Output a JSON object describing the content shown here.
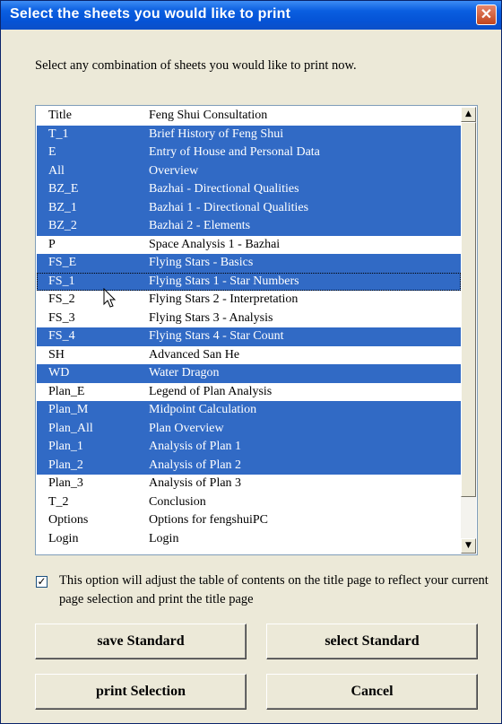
{
  "window": {
    "title": "Select the sheets you would like to print",
    "close": "✕"
  },
  "instruction": "Select any combination of sheets you would like to print now.",
  "sheets": [
    {
      "code": "Title",
      "name": "Feng Shui Consultation",
      "selected": false
    },
    {
      "code": "T_1",
      "name": "Brief History of  Feng Shui",
      "selected": true
    },
    {
      "code": "E",
      "name": "Entry of House and Personal Data",
      "selected": true
    },
    {
      "code": "All",
      "name": "Overview",
      "selected": true
    },
    {
      "code": "BZ_E",
      "name": "Bazhai - Directional Qualities",
      "selected": true
    },
    {
      "code": "BZ_1",
      "name": "Bazhai 1 - Directional Qualities",
      "selected": true
    },
    {
      "code": "BZ_2",
      "name": "Bazhai 2 - Elements",
      "selected": true
    },
    {
      "code": "P",
      "name": "Space Analysis 1 - Bazhai",
      "selected": false
    },
    {
      "code": "FS_E",
      "name": "Flying Stars - Basics",
      "selected": true
    },
    {
      "code": "FS_1",
      "name": "Flying Stars 1 - Star Numbers",
      "selected": true,
      "focused": true
    },
    {
      "code": "FS_2",
      "name": "Flying Stars 2 - Interpretation",
      "selected": false
    },
    {
      "code": "FS_3",
      "name": "Flying Stars 3 - Analysis",
      "selected": false
    },
    {
      "code": "FS_4",
      "name": "Flying Stars 4 - Star Count",
      "selected": true
    },
    {
      "code": "SH",
      "name": "Advanced San He",
      "selected": false
    },
    {
      "code": "WD",
      "name": "Water Dragon",
      "selected": true
    },
    {
      "code": "Plan_E",
      "name": "Legend of Plan Analysis",
      "selected": false
    },
    {
      "code": "Plan_M",
      "name": "Midpoint Calculation",
      "selected": true
    },
    {
      "code": "Plan_All",
      "name": "Plan Overview",
      "selected": true
    },
    {
      "code": "Plan_1",
      "name": "Analysis of Plan 1",
      "selected": true
    },
    {
      "code": "Plan_2",
      "name": "Analysis of Plan 2",
      "selected": true
    },
    {
      "code": "Plan_3",
      "name": "Analysis of Plan 3",
      "selected": false
    },
    {
      "code": "T_2",
      "name": "Conclusion",
      "selected": false
    },
    {
      "code": "Options",
      "name": "Options for fengshuiPC",
      "selected": false
    },
    {
      "code": "Login",
      "name": "Login",
      "selected": false
    }
  ],
  "scrollbar": {
    "up": "▲",
    "down": "▼"
  },
  "option": {
    "checked": true,
    "mark": "✓",
    "text": "This option will adjust the table of contents on the title page to reflect your current page selection and print the title page"
  },
  "buttons": {
    "save": "save Standard",
    "select": "select Standard",
    "print": "print Selection",
    "cancel": "Cancel"
  },
  "colors": {
    "selection": "#316ac5",
    "titlebar": "#0553d6",
    "face": "#ece9d8"
  }
}
